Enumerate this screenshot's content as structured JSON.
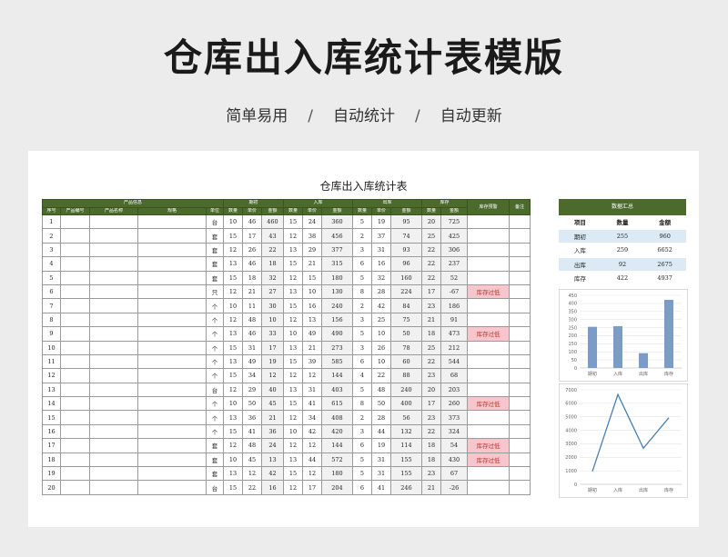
{
  "hero": {
    "title": "仓库出入库统计表模版",
    "subtitle_items": [
      "简单易用",
      "自动统计",
      "自动更新"
    ],
    "separator": "/"
  },
  "sheet": {
    "title": "仓库出入库统计表",
    "header_groups": {
      "product_info": "产品信息",
      "opening": "期初",
      "inbound": "入库",
      "outbound": "出库",
      "stock": "库存",
      "alert": "库存预警",
      "remark": "备注"
    },
    "header_cols": {
      "seq": "序号",
      "code": "产品编号",
      "name": "产品名称",
      "spec": "规格",
      "unit": "单位",
      "qty": "数量",
      "price": "单价",
      "amount": "金额"
    },
    "warning_text": "库存过低",
    "rows": [
      {
        "no": "1",
        "unit": "台",
        "o": [
          "10",
          "46",
          "460"
        ],
        "i": [
          "15",
          "24",
          "360"
        ],
        "out": [
          "5",
          "19",
          "95"
        ],
        "s": [
          "20",
          "725"
        ],
        "warn": false
      },
      {
        "no": "2",
        "unit": "套",
        "o": [
          "15",
          "17",
          "43"
        ],
        "i": [
          "12",
          "38",
          "456"
        ],
        "out": [
          "2",
          "37",
          "74"
        ],
        "s": [
          "25",
          "425"
        ],
        "warn": false
      },
      {
        "no": "3",
        "unit": "套",
        "o": [
          "12",
          "26",
          "22"
        ],
        "i": [
          "13",
          "29",
          "377"
        ],
        "out": [
          "3",
          "31",
          "93"
        ],
        "s": [
          "22",
          "306"
        ],
        "warn": false
      },
      {
        "no": "4",
        "unit": "套",
        "o": [
          "13",
          "46",
          "18"
        ],
        "i": [
          "15",
          "21",
          "315"
        ],
        "out": [
          "6",
          "16",
          "96"
        ],
        "s": [
          "22",
          "237"
        ],
        "warn": false
      },
      {
        "no": "5",
        "unit": "套",
        "o": [
          "15",
          "18",
          "32"
        ],
        "i": [
          "12",
          "15",
          "180"
        ],
        "out": [
          "5",
          "32",
          "160"
        ],
        "s": [
          "22",
          "52"
        ],
        "warn": false
      },
      {
        "no": "6",
        "unit": "只",
        "o": [
          "12",
          "21",
          "27"
        ],
        "i": [
          "13",
          "10",
          "130"
        ],
        "out": [
          "8",
          "28",
          "224"
        ],
        "s": [
          "17",
          "-67"
        ],
        "warn": true
      },
      {
        "no": "7",
        "unit": "个",
        "o": [
          "10",
          "11",
          "30"
        ],
        "i": [
          "15",
          "16",
          "240"
        ],
        "out": [
          "2",
          "42",
          "84"
        ],
        "s": [
          "23",
          "186"
        ],
        "warn": false
      },
      {
        "no": "8",
        "unit": "个",
        "o": [
          "12",
          "48",
          "10"
        ],
        "i": [
          "12",
          "13",
          "156"
        ],
        "out": [
          "3",
          "25",
          "75"
        ],
        "s": [
          "21",
          "91"
        ],
        "warn": false
      },
      {
        "no": "9",
        "unit": "个",
        "o": [
          "13",
          "46",
          "33"
        ],
        "i": [
          "10",
          "49",
          "490"
        ],
        "out": [
          "5",
          "10",
          "50"
        ],
        "s": [
          "18",
          "473"
        ],
        "warn": true
      },
      {
        "no": "10",
        "unit": "个",
        "o": [
          "15",
          "31",
          "17"
        ],
        "i": [
          "13",
          "21",
          "273"
        ],
        "out": [
          "3",
          "26",
          "78"
        ],
        "s": [
          "25",
          "212"
        ],
        "warn": false
      },
      {
        "no": "11",
        "unit": "个",
        "o": [
          "13",
          "49",
          "19"
        ],
        "i": [
          "15",
          "39",
          "585"
        ],
        "out": [
          "6",
          "10",
          "60"
        ],
        "s": [
          "22",
          "544"
        ],
        "warn": false
      },
      {
        "no": "12",
        "unit": "个",
        "o": [
          "15",
          "34",
          "12"
        ],
        "i": [
          "12",
          "12",
          "144"
        ],
        "out": [
          "4",
          "22",
          "88"
        ],
        "s": [
          "23",
          "68"
        ],
        "warn": false
      },
      {
        "no": "13",
        "unit": "台",
        "o": [
          "12",
          "29",
          "40"
        ],
        "i": [
          "13",
          "31",
          "403"
        ],
        "out": [
          "5",
          "48",
          "240"
        ],
        "s": [
          "20",
          "203"
        ],
        "warn": false
      },
      {
        "no": "14",
        "unit": "个",
        "o": [
          "10",
          "50",
          "45"
        ],
        "i": [
          "15",
          "41",
          "615"
        ],
        "out": [
          "8",
          "50",
          "400"
        ],
        "s": [
          "17",
          "260"
        ],
        "warn": true
      },
      {
        "no": "15",
        "unit": "个",
        "o": [
          "13",
          "36",
          "21"
        ],
        "i": [
          "12",
          "34",
          "408"
        ],
        "out": [
          "2",
          "28",
          "56"
        ],
        "s": [
          "23",
          "373"
        ],
        "warn": false
      },
      {
        "no": "16",
        "unit": "个",
        "o": [
          "15",
          "41",
          "36"
        ],
        "i": [
          "10",
          "42",
          "420"
        ],
        "out": [
          "3",
          "44",
          "132"
        ],
        "s": [
          "22",
          "324"
        ],
        "warn": false
      },
      {
        "no": "17",
        "unit": "套",
        "o": [
          "12",
          "48",
          "24"
        ],
        "i": [
          "12",
          "12",
          "144"
        ],
        "out": [
          "6",
          "19",
          "114"
        ],
        "s": [
          "18",
          "54"
        ],
        "warn": true
      },
      {
        "no": "18",
        "unit": "套",
        "o": [
          "10",
          "45",
          "13"
        ],
        "i": [
          "13",
          "44",
          "572"
        ],
        "out": [
          "5",
          "31",
          "155"
        ],
        "s": [
          "18",
          "430"
        ],
        "warn": true
      },
      {
        "no": "19",
        "unit": "套",
        "o": [
          "13",
          "12",
          "42"
        ],
        "i": [
          "15",
          "12",
          "180"
        ],
        "out": [
          "5",
          "31",
          "155"
        ],
        "s": [
          "23",
          "67"
        ],
        "warn": false
      },
      {
        "no": "20",
        "unit": "台",
        "o": [
          "15",
          "22",
          "16"
        ],
        "i": [
          "12",
          "17",
          "204"
        ],
        "out": [
          "6",
          "41",
          "246"
        ],
        "s": [
          "21",
          "-26"
        ],
        "warn": false
      }
    ]
  },
  "summary": {
    "title": "数据汇总",
    "headers": [
      "项目",
      "数量",
      "金额"
    ],
    "rows": [
      {
        "item": "期初",
        "qty": "255",
        "amount": "960"
      },
      {
        "item": "入库",
        "qty": "259",
        "amount": "6652"
      },
      {
        "item": "出库",
        "qty": "92",
        "amount": "2675"
      },
      {
        "item": "库存",
        "qty": "422",
        "amount": "4937"
      }
    ]
  },
  "chart_data": [
    {
      "type": "bar",
      "categories": [
        "期初",
        "入库",
        "出库",
        "库存"
      ],
      "values": [
        255,
        259,
        92,
        422
      ],
      "ylim": [
        0,
        450
      ],
      "yticks": [
        0,
        50,
        100,
        150,
        200,
        250,
        300,
        350,
        400,
        450
      ],
      "grid": true,
      "color": "#7b9cc7"
    },
    {
      "type": "line",
      "categories": [
        "期初",
        "入库",
        "出库",
        "库存"
      ],
      "values": [
        960,
        6652,
        2675,
        4937
      ],
      "ylim": [
        0,
        7000
      ],
      "yticks": [
        0,
        1000,
        2000,
        3000,
        4000,
        5000,
        6000,
        7000
      ],
      "grid": true,
      "color": "#4a7fb5"
    }
  ]
}
